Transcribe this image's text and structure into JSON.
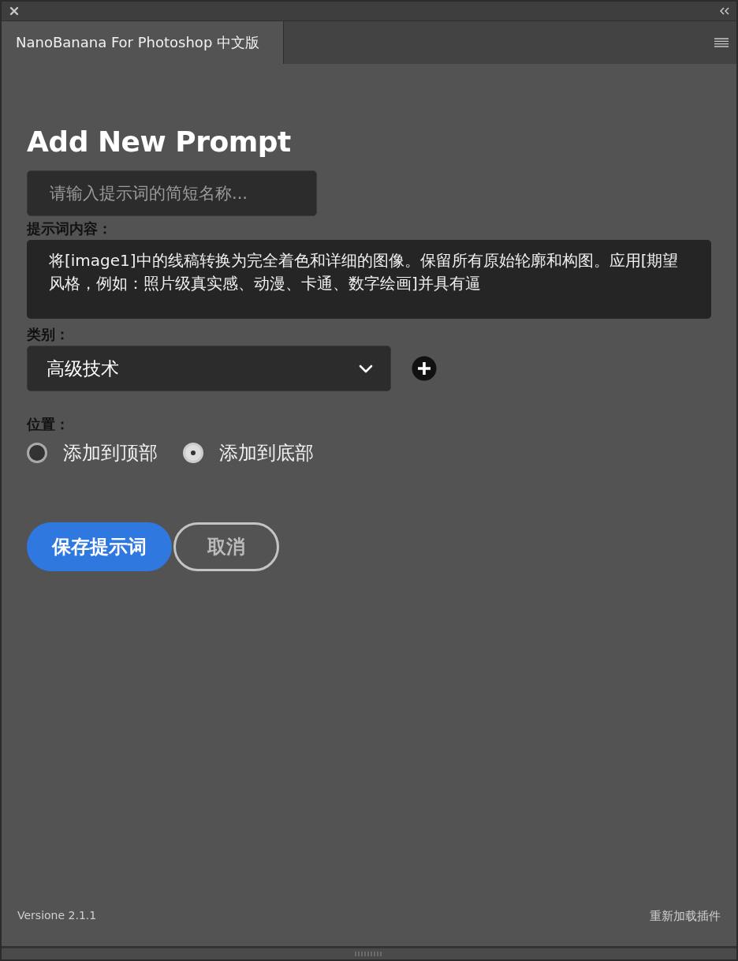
{
  "panel": {
    "tab": "NanoBanana For Photoshop 中文版"
  },
  "form": {
    "title": "Add New Prompt",
    "name_field": {
      "placeholder": "请输入提示词的简短名称..."
    },
    "content_label": "提示词内容：",
    "content_field": {
      "value": "将[image1]中的线稿转换为完全着色和详细的图像。保留所有原始轮廓和构图。应用[期望风格，例如：照片级真实感、动漫、卡通、数字绘画]并具有逼"
    },
    "category_label": "类别：",
    "category_select": {
      "value": "高级技术"
    },
    "position_label": "位置：",
    "positions": [
      {
        "label": "添加到顶部",
        "selected": false
      },
      {
        "label": "添加到底部",
        "selected": true
      }
    ],
    "buttons": [
      {
        "label": "保存提示词",
        "kind": "primary"
      },
      {
        "label": "取消",
        "kind": "secondary"
      }
    ]
  },
  "footer": {
    "version": "Versione 2.1.1",
    "reload": "重新加载插件"
  }
}
